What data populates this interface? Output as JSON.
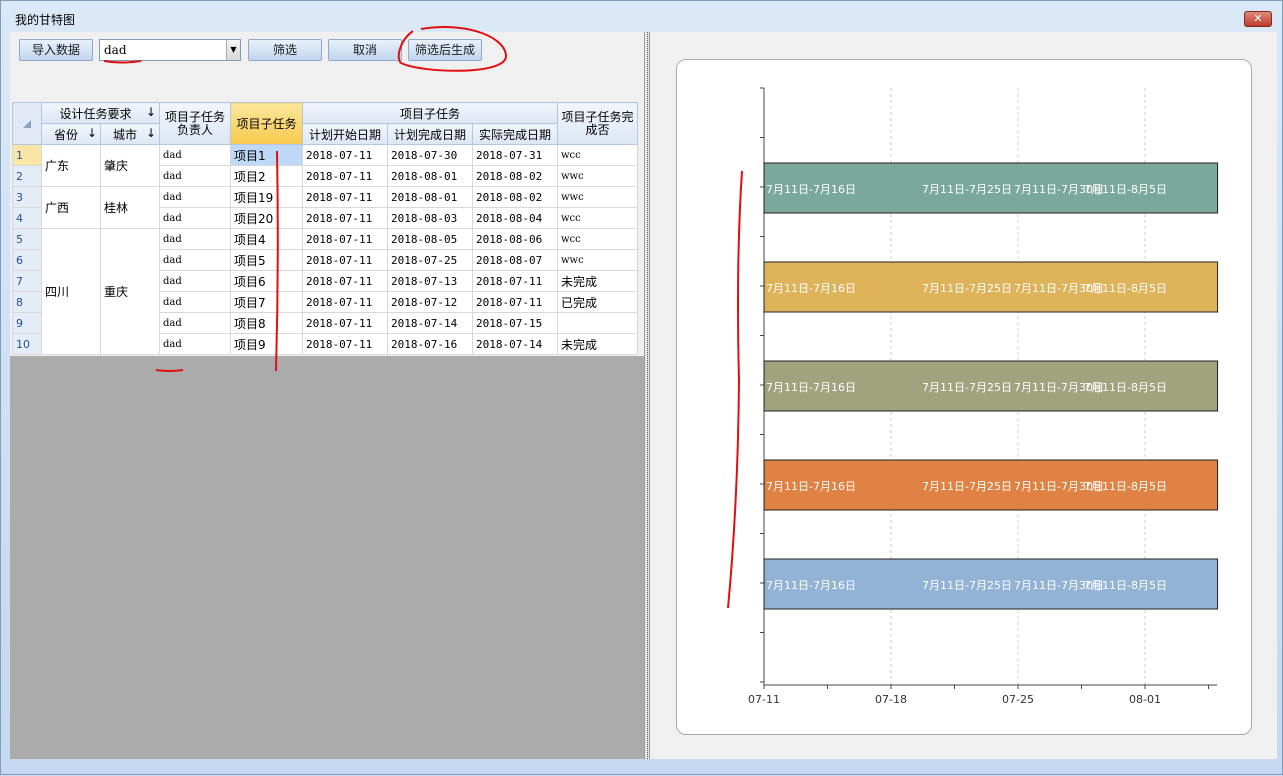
{
  "window": {
    "title": "我的甘特图",
    "close_label": "✕"
  },
  "toolbar": {
    "import_label": "导入数据",
    "filter_value": "dad",
    "filter_label": "筛选",
    "cancel_label": "取消",
    "generate_label": "筛选后生成"
  },
  "grid": {
    "headers": {
      "group1": "设计任务要求",
      "province": "省份",
      "city": "城市",
      "owner": "项目子任务负责人",
      "task": "项目子任务",
      "group2": "项目子任务",
      "plan_start": "计划开始日期",
      "plan_end": "计划完成日期",
      "actual_end": "实际完成日期",
      "done": "项目子任务完成否",
      "sort": "↓"
    },
    "groups": [
      {
        "province": "广东",
        "city": "肇庆"
      },
      {
        "province": "广西",
        "city": "桂林"
      },
      {
        "province": "四川",
        "city": "重庆"
      }
    ],
    "rows": [
      {
        "n": "1",
        "owner": "dad",
        "task": "项目1",
        "start": "2018-07-11",
        "end": "2018-07-30",
        "actual": "2018-07-31",
        "done": "wcc"
      },
      {
        "n": "2",
        "owner": "dad",
        "task": "项目2",
        "start": "2018-07-11",
        "end": "2018-08-01",
        "actual": "2018-08-02",
        "done": "wwc"
      },
      {
        "n": "3",
        "owner": "dad",
        "task": "项目19",
        "start": "2018-07-11",
        "end": "2018-08-01",
        "actual": "2018-08-02",
        "done": "wwc"
      },
      {
        "n": "4",
        "owner": "dad",
        "task": "项目20",
        "start": "2018-07-11",
        "end": "2018-08-03",
        "actual": "2018-08-04",
        "done": "wcc"
      },
      {
        "n": "5",
        "owner": "dad",
        "task": "项目4",
        "start": "2018-07-11",
        "end": "2018-08-05",
        "actual": "2018-08-06",
        "done": "wcc"
      },
      {
        "n": "6",
        "owner": "dad",
        "task": "项目5",
        "start": "2018-07-11",
        "end": "2018-07-25",
        "actual": "2018-08-07",
        "done": "wwc"
      },
      {
        "n": "7",
        "owner": "dad",
        "task": "项目6",
        "start": "2018-07-11",
        "end": "2018-07-13",
        "actual": "2018-07-11",
        "done": "未完成"
      },
      {
        "n": "8",
        "owner": "dad",
        "task": "项目7",
        "start": "2018-07-11",
        "end": "2018-07-12",
        "actual": "2018-07-11",
        "done": "已完成"
      },
      {
        "n": "9",
        "owner": "dad",
        "task": "项目8",
        "start": "2018-07-11",
        "end": "2018-07-14",
        "actual": "2018-07-15",
        "done": ""
      },
      {
        "n": "10",
        "owner": "dad",
        "task": "项目9",
        "start": "2018-07-11",
        "end": "2018-07-16",
        "actual": "2018-07-14",
        "done": "未完成"
      }
    ]
  },
  "chart_data": {
    "type": "bar",
    "orientation": "horizontal",
    "x_ticks": [
      "07-11",
      "07-18",
      "07-25",
      "08-01"
    ],
    "xlim": [
      "2018-07-11",
      "2018-08-05"
    ],
    "grid": "vertical dashed",
    "bars": [
      {
        "start": "2018-07-11",
        "end": "2018-08-05",
        "color": "#7aa89a",
        "labels": [
          "7月11日-7月16日",
          "7月11日-7月25日",
          "7月11日-7月30日",
          "7月11日-8月5日"
        ]
      },
      {
        "start": "2018-07-11",
        "end": "2018-08-05",
        "color": "#dfb35a",
        "labels": [
          "7月11日-7月16日",
          "7月11日-7月25日",
          "7月11日-7月30日",
          "7月11日-8月5日"
        ]
      },
      {
        "start": "2018-07-11",
        "end": "2018-08-05",
        "color": "#9fa37e",
        "labels": [
          "7月11日-7月16日",
          "7月11日-7月25日",
          "7月11日-7月30日",
          "7月11日-8月5日"
        ]
      },
      {
        "start": "2018-07-11",
        "end": "2018-08-05",
        "color": "#df8243",
        "labels": [
          "7月11日-7月16日",
          "7月11日-7月25日",
          "7月11日-7月30日",
          "7月11日-8月5日"
        ]
      },
      {
        "start": "2018-07-11",
        "end": "2018-08-05",
        "color": "#93b3d6",
        "labels": [
          "7月11日-7月16日",
          "7月11日-7月25日",
          "7月11日-7月30日",
          "7月11日-8月5日"
        ]
      }
    ]
  }
}
